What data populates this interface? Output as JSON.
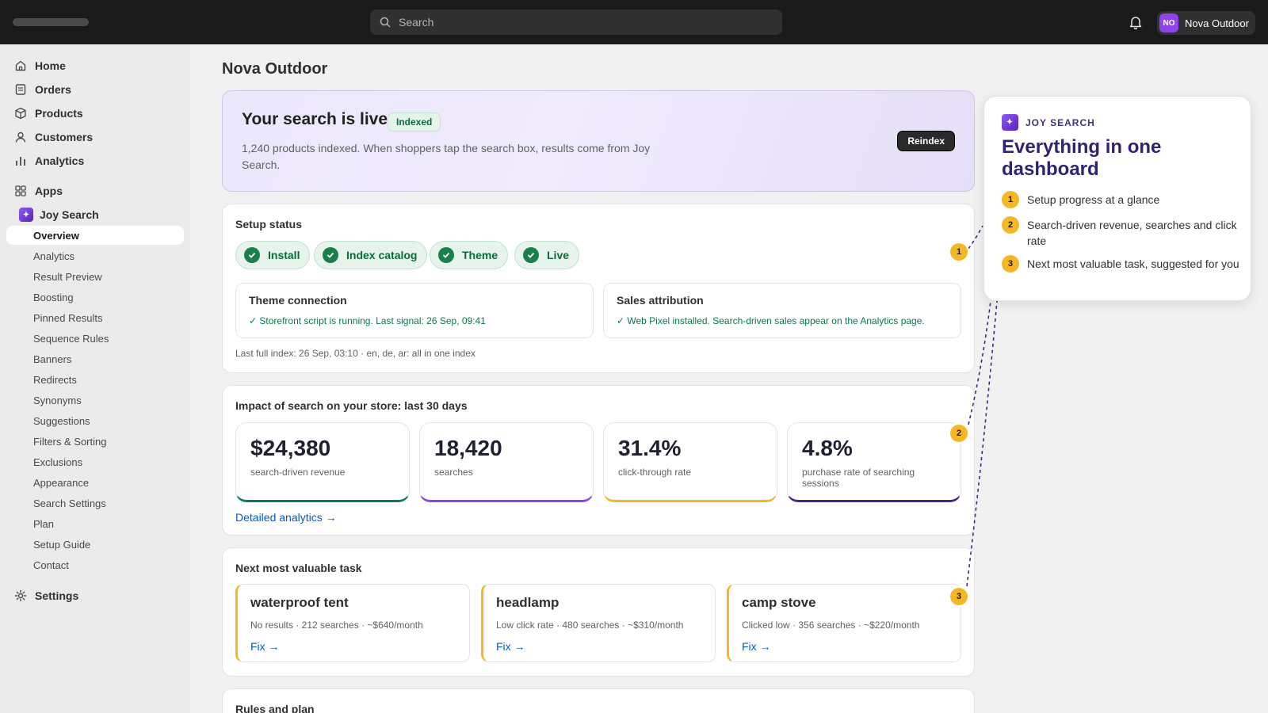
{
  "topbar": {
    "search_placeholder": "Search",
    "store_initials": "NO",
    "store_name": "Nova Outdoor"
  },
  "sidebar": {
    "items": [
      {
        "label": "Home",
        "icon": "home-icon"
      },
      {
        "label": "Orders",
        "icon": "orders-icon"
      },
      {
        "label": "Products",
        "icon": "products-icon"
      },
      {
        "label": "Customers",
        "icon": "customers-icon"
      },
      {
        "label": "Analytics",
        "icon": "analytics-icon"
      }
    ],
    "apps_label": "Apps",
    "app_name": "Joy Search",
    "app_subitems": [
      "Overview",
      "Analytics",
      "Result Preview",
      "Boosting",
      "Pinned Results",
      "Sequence Rules",
      "Banners",
      "Redirects",
      "Synonyms",
      "Suggestions",
      "Filters & Sorting",
      "Exclusions",
      "Appearance",
      "Search Settings",
      "Plan",
      "Setup Guide",
      "Contact"
    ],
    "active_subitem": "Overview",
    "settings_label": "Settings"
  },
  "page": {
    "title": "Nova Outdoor"
  },
  "hero": {
    "title": "Your search is live",
    "badge": "Indexed",
    "description": "1,240 products indexed. When shoppers tap the search box, results come from Joy Search.",
    "button": "Reindex"
  },
  "setup": {
    "title": "Setup status",
    "steps": [
      "Install",
      "Index catalog",
      "Theme",
      "Live"
    ],
    "theme_title": "Theme connection",
    "theme_text": "✓ Storefront script is running. Last signal: 26 Sep, 09:41",
    "sales_title": "Sales attribution",
    "sales_text": "✓ Web Pixel installed. Search-driven sales appear on the Analytics page.",
    "last_index": "Last full index: 26 Sep, 03:10 · en, de, ar: all in one index"
  },
  "impact": {
    "title": "Impact of search on your store: last 30 days",
    "kpis": [
      {
        "value": "$24,380",
        "label": "search-driven revenue",
        "color": "#0e7a5a"
      },
      {
        "value": "18,420",
        "label": "searches",
        "color": "#8b45e6"
      },
      {
        "value": "31.4%",
        "label": "click-through rate",
        "color": "#f5b824"
      },
      {
        "value": "4.8%",
        "label": "purchase rate of searching sessions",
        "color": "#3b2a8c"
      }
    ],
    "link": "Detailed analytics →"
  },
  "tasks": {
    "title": "Next most valuable task",
    "items": [
      {
        "title": "waterproof tent",
        "meta": "No results · 212 searches · ~$640/month",
        "fix": "Fix →"
      },
      {
        "title": "headlamp",
        "meta": "Low click rate · 480 searches · ~$310/month",
        "fix": "Fix →"
      },
      {
        "title": "camp stove",
        "meta": "Clicked low · 356 searches · ~$220/month",
        "fix": "Fix →"
      }
    ]
  },
  "rules": {
    "title": "Rules and plan"
  },
  "callout": {
    "kicker": "JOY SEARCH",
    "title": "Everything in one dashboard",
    "items": [
      {
        "num": "1",
        "text": "Setup progress at a glance"
      },
      {
        "num": "2",
        "text": "Search-driven revenue, searches and click rate"
      },
      {
        "num": "3",
        "text": "Next most valuable task, suggested for you"
      }
    ],
    "accent": "#f5b824"
  }
}
